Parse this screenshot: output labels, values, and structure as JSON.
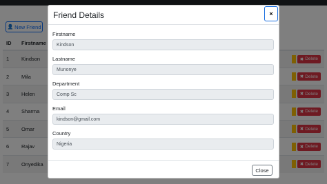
{
  "toolbar": {
    "new_friend_label": "New Friend",
    "new_friend_icon": "user-icon"
  },
  "table": {
    "headers": [
      "ID",
      "Firstname"
    ],
    "rows": [
      {
        "id": "1",
        "firstname": "Kindson"
      },
      {
        "id": "2",
        "firstname": "Mila"
      },
      {
        "id": "3",
        "firstname": "Helen"
      },
      {
        "id": "4",
        "firstname": "Sharma"
      },
      {
        "id": "5",
        "firstname": "Omar"
      },
      {
        "id": "6",
        "firstname": "Rajav"
      },
      {
        "id": "7",
        "firstname": "Onyedika"
      }
    ],
    "delete_label": "Delete"
  },
  "modal": {
    "title": "Friend Details",
    "close_icon": "×",
    "fields": [
      {
        "label": "Firstname",
        "value": "Kindson"
      },
      {
        "label": "Lastname",
        "value": "Munonye"
      },
      {
        "label": "Department",
        "value": "Comp Sc"
      },
      {
        "label": "Email",
        "value": "kindson@gmail.com"
      },
      {
        "label": "Country",
        "value": "Nigeria"
      }
    ],
    "close_label": "Close"
  },
  "colors": {
    "primary": "#0d6efd",
    "danger": "#dc3545",
    "warning": "#ffc107",
    "backdrop": "rgba(0,0,0,0.5)"
  }
}
